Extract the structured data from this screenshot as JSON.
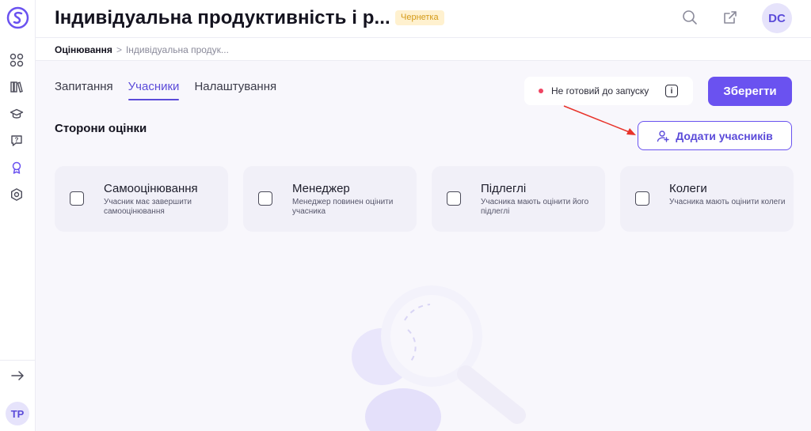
{
  "header": {
    "title": "Індивідуальна продуктивність і р...",
    "draft_badge": "Чернетка",
    "avatar_initials": "DC"
  },
  "breadcrumb": {
    "parent": "Оцінювання",
    "separator": ">",
    "current": "Індивідуальна продук..."
  },
  "sidebar": {
    "items": [
      {
        "icon": "dashboard-grid-icon"
      },
      {
        "icon": "library-books-icon"
      },
      {
        "icon": "graduation-cap-icon"
      },
      {
        "icon": "question-chat-icon"
      },
      {
        "icon": "award-badge-icon",
        "active": true
      },
      {
        "icon": "settings-hexagon-icon"
      }
    ],
    "expand_icon": "arrow-right-icon",
    "user_initials": "TP"
  },
  "tabs": [
    {
      "label": "Запитання",
      "active": false
    },
    {
      "label": "Учасники",
      "active": true
    },
    {
      "label": "Налаштування",
      "active": false
    }
  ],
  "status": {
    "text": "Не готовий до запуску",
    "info": "i"
  },
  "save_label": "Зберегти",
  "section_title": "Сторони оцінки",
  "add_participants_label": "Додати учасників",
  "cards": [
    {
      "title": "Самооцінювання",
      "description": "Учасник має завершити самооцінювання"
    },
    {
      "title": "Менеджер",
      "description": "Менеджер повинен оцінити учасника"
    },
    {
      "title": "Підлеглі",
      "description": "Учасника мають оцінити його підлеглі"
    },
    {
      "title": "Колеги",
      "description": "Учасника мають оцінити колеги"
    }
  ],
  "colors": {
    "accent": "#6a52f0",
    "status_dot": "#ef4562",
    "draft_badge_bg": "#fff1cf",
    "draft_badge_text": "#d49a18",
    "annotation": "#e8332a"
  }
}
